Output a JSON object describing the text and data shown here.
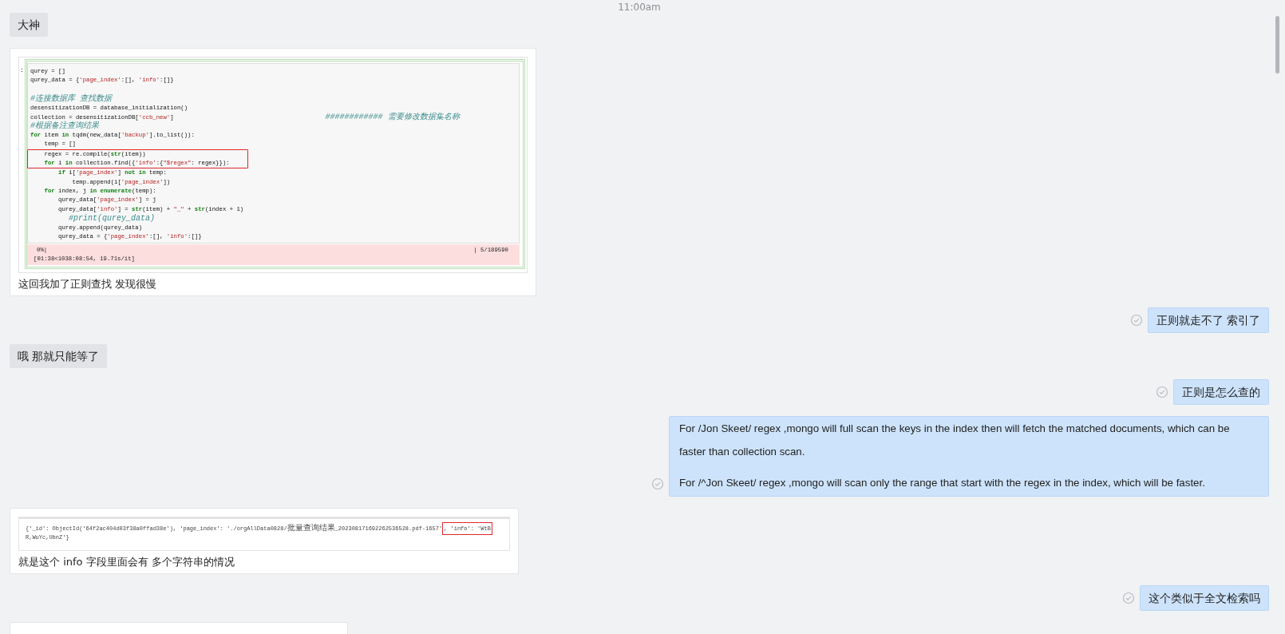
{
  "timestamp": "11:00am",
  "messages": [
    {
      "kind": "text",
      "mine": false,
      "text": "大神"
    },
    {
      "kind": "image",
      "mine": false,
      "caption": "这回我加了正则查找 发现很慢",
      "screenshot": {
        "kind": "notebook",
        "prompt": ":",
        "lines": [
          {
            "boxed": false,
            "tokens": [
              {
                "kind": "plain",
                "text": "qurey = []"
              }
            ]
          },
          {
            "boxed": false,
            "tokens": [
              {
                "kind": "plain",
                "text": "qurey_data = {"
              },
              {
                "kind": "str",
                "text": "'page_index'"
              },
              {
                "kind": "plain",
                "text": ":[], "
              },
              {
                "kind": "str",
                "text": "'info'"
              },
              {
                "kind": "plain",
                "text": ":[]}"
              }
            ]
          },
          {
            "kind": "blank"
          },
          {
            "boxed": false,
            "tokens": [
              {
                "kind": "comment",
                "text": "#连接数据库 查找数据"
              }
            ]
          },
          {
            "boxed": false,
            "tokens": [
              {
                "kind": "plain",
                "text": "desensitizationDB = database_initialization()"
              }
            ]
          },
          {
            "boxed": false,
            "tokens": [
              {
                "kind": "plain",
                "text": "collection = desensitizationDB["
              },
              {
                "kind": "str",
                "text": "'ccb_new'"
              },
              {
                "kind": "plain",
                "text": "]"
              },
              {
                "kind": "aside",
                "text": "############ 需要修改数据集名称"
              }
            ]
          },
          {
            "boxed": false,
            "tokens": [
              {
                "kind": "comment",
                "text": "#根据备注查询结果"
              }
            ]
          },
          {
            "boxed": false,
            "tokens": [
              {
                "kind": "kw",
                "text": "for"
              },
              {
                "kind": "plain",
                "text": " item "
              },
              {
                "kind": "kw",
                "text": "in"
              },
              {
                "kind": "plain",
                "text": " tqdm(new_data["
              },
              {
                "kind": "str",
                "text": "'backup'"
              },
              {
                "kind": "plain",
                "text": "].to_list()):"
              }
            ]
          },
          {
            "boxed": false,
            "tokens": [
              {
                "kind": "plain",
                "text": "    temp = []"
              }
            ]
          },
          {
            "boxed": true,
            "tokens": [
              {
                "kind": "plain",
                "text": "    regex = re.compile("
              },
              {
                "kind": "kw",
                "text": "str"
              },
              {
                "kind": "plain",
                "text": "(item))"
              }
            ]
          },
          {
            "boxed": true,
            "tokens": [
              {
                "kind": "kw",
                "text": "    for"
              },
              {
                "kind": "plain",
                "text": " i "
              },
              {
                "kind": "kw",
                "text": "in"
              },
              {
                "kind": "plain",
                "text": " collection.find({"
              },
              {
                "kind": "str",
                "text": "'info'"
              },
              {
                "kind": "plain",
                "text": ":{"
              },
              {
                "kind": "str",
                "text": "\"$regex\""
              },
              {
                "kind": "plain",
                "text": ": regex}}):"
              }
            ]
          },
          {
            "boxed": false,
            "tokens": [
              {
                "kind": "kw",
                "text": "        if"
              },
              {
                "kind": "plain",
                "text": " i["
              },
              {
                "kind": "str",
                "text": "'page_index'"
              },
              {
                "kind": "plain",
                "text": "] "
              },
              {
                "kind": "kw",
                "text": "not in"
              },
              {
                "kind": "plain",
                "text": " temp:"
              }
            ]
          },
          {
            "boxed": false,
            "tokens": [
              {
                "kind": "plain",
                "text": "            temp.append(i["
              },
              {
                "kind": "str",
                "text": "'page_index'"
              },
              {
                "kind": "plain",
                "text": "])"
              }
            ]
          },
          {
            "boxed": false,
            "tokens": [
              {
                "kind": "kw",
                "text": "    for"
              },
              {
                "kind": "plain",
                "text": " index, j "
              },
              {
                "kind": "kw",
                "text": "in enumerate"
              },
              {
                "kind": "plain",
                "text": "(temp):"
              }
            ]
          },
          {
            "boxed": false,
            "tokens": [
              {
                "kind": "plain",
                "text": "        qurey_data["
              },
              {
                "kind": "str",
                "text": "'page_index'"
              },
              {
                "kind": "plain",
                "text": "] = j"
              }
            ]
          },
          {
            "boxed": false,
            "tokens": [
              {
                "kind": "plain",
                "text": "        qurey_data["
              },
              {
                "kind": "str",
                "text": "'info'"
              },
              {
                "kind": "plain",
                "text": "] = "
              },
              {
                "kind": "kw",
                "text": "str"
              },
              {
                "kind": "plain",
                "text": "(item) + "
              },
              {
                "kind": "str",
                "text": "\"_\""
              },
              {
                "kind": "plain",
                "text": " + "
              },
              {
                "kind": "kw",
                "text": "str"
              },
              {
                "kind": "plain",
                "text": "(index + 1)"
              }
            ]
          },
          {
            "boxed": false,
            "tokens": [
              {
                "kind": "comment",
                "text": "        #print(qurey_data)"
              }
            ]
          },
          {
            "boxed": false,
            "tokens": [
              {
                "kind": "plain",
                "text": "        qurey.append(qurey_data)"
              }
            ]
          },
          {
            "boxed": false,
            "tokens": [
              {
                "kind": "plain",
                "text": "        qurey_data = {"
              },
              {
                "kind": "str",
                "text": "'page_index'"
              },
              {
                "kind": "plain",
                "text": ":[], "
              },
              {
                "kind": "str",
                "text": "'info'"
              },
              {
                "kind": "plain",
                "text": ":[]}"
              }
            ]
          }
        ],
        "output": {
          "progress": "0%|",
          "count": "| 5/189590",
          "timing": "[01:38<1038:08:54, 19.71s/it]"
        }
      }
    },
    {
      "kind": "text",
      "mine": true,
      "text": "正则就走不了 索引了"
    },
    {
      "kind": "text",
      "mine": false,
      "text": "哦 那就只能等了"
    },
    {
      "kind": "text",
      "mine": true,
      "text": "正则是怎么查的"
    },
    {
      "kind": "paragraphs",
      "mine": true,
      "paragraphs": [
        "For /Jon Skeet/ regex ,mongo will full scan the keys in the index then will fetch the matched documents, which can be faster than collection scan.",
        "For /^Jon Skeet/ regex ,mongo will scan only the range that start with the regex in the index, which will be faster."
      ]
    },
    {
      "kind": "image",
      "mine": false,
      "caption": "就是这个 info 字段里面会有 多个字符串的情况",
      "screenshot": {
        "kind": "output",
        "lines": [
          {
            "boxed": false,
            "tokens": [
              {
                "kind": "plain",
                "text": "{'_id': ObjectId('64f2ac404d03f38a0ffad38e'), 'page_index': './orgAllData0828/"
              },
              {
                "kind": "zh",
                "text": "批量查询结果"
              },
              {
                "kind": "plain",
                "text": "_202308171692262536528.pdf-1657'"
              },
              {
                "kind": "boxed",
                "text": ", 'info': 'WtB"
              }
            ]
          },
          {
            "boxed": false,
            "tokens": [
              {
                "kind": "plain",
                "text": "R,WuYc,UbnZ'}"
              }
            ]
          }
        ]
      }
    },
    {
      "kind": "text",
      "mine": true,
      "text": "这个类似于全文检索吗"
    },
    {
      "kind": "cutoff",
      "mine": false
    }
  ]
}
